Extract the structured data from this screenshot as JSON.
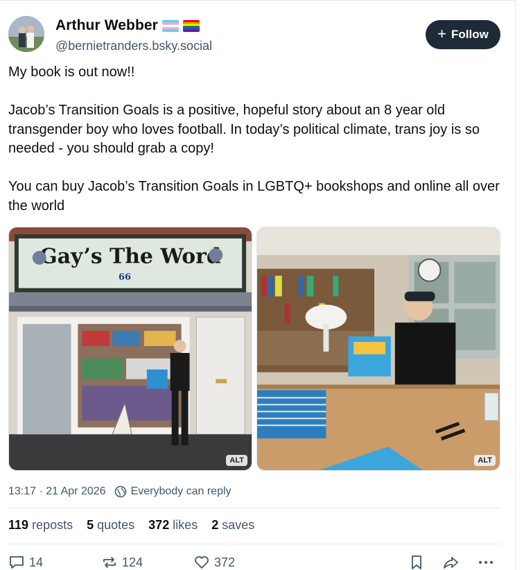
{
  "author": {
    "display_name": "Arthur Webber",
    "handle": "@bernietranders.bsky.social",
    "flags": [
      "transgender-flag",
      "rainbow-flag"
    ]
  },
  "follow_button": {
    "label": "Follow",
    "icon": "plus-icon"
  },
  "post": {
    "paragraphs": [
      "My book is out now!!",
      "Jacob’s Transition Goals is a positive, hopeful story about an 8 year old transgender boy who loves football. In today’s political climate, trans joy is so needed - you should grab a copy!",
      "You can buy Jacob’s Transition Goals in LGBTQ+ bookshops and online all over the world"
    ],
    "images": [
      {
        "alt_badge": "ALT",
        "shop_sign": "Gay’s The Word",
        "shop_number": "66"
      },
      {
        "alt_badge": "ALT"
      }
    ],
    "timestamp": "13:17 · 21 Apr 2026",
    "reply_setting": "Everybody can reply"
  },
  "stats": {
    "reposts": {
      "count": "119",
      "label": "reposts"
    },
    "quotes": {
      "count": "5",
      "label": "quotes"
    },
    "likes": {
      "count": "372",
      "label": "likes"
    },
    "saves": {
      "count": "2",
      "label": "saves"
    }
  },
  "actions": {
    "reply_count": "14",
    "repost_count": "124",
    "like_count": "372"
  },
  "colors": {
    "follow_bg": "#1e2a38",
    "muted_text": "#42576c",
    "divider": "#e6e8eb"
  }
}
